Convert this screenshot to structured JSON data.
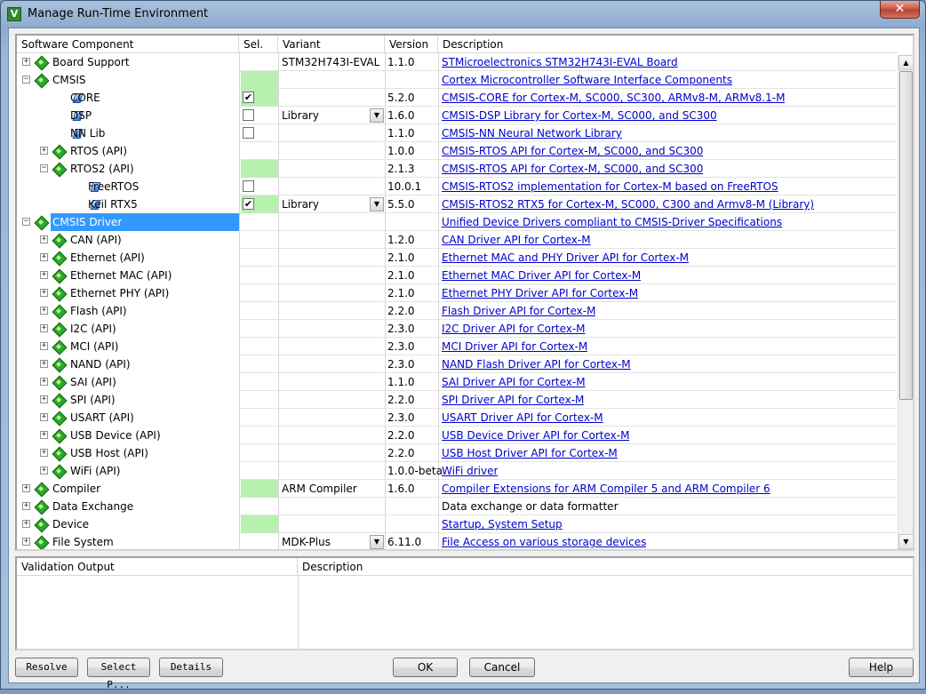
{
  "window": {
    "title": "Manage Run-Time Environment",
    "app_icon_letter": "V",
    "close_label": "✕"
  },
  "columns": {
    "component": "Software Component",
    "sel": "Sel.",
    "variant": "Variant",
    "version": "Version",
    "description": "Description"
  },
  "rows": [
    {
      "indent": 0,
      "expander": "+",
      "icon": "green-gem",
      "name": "Board Support",
      "sel": "",
      "checkbox": null,
      "variant": "STM32H743I-EVAL",
      "dropdown": false,
      "version": "1.1.0",
      "description": "STMicroelectronics STM32H743I-EVAL Board",
      "link": true,
      "highlight": false
    },
    {
      "indent": 0,
      "expander": "−",
      "icon": "green-gem",
      "name": "CMSIS",
      "sel": "green",
      "checkbox": null,
      "variant": "",
      "dropdown": false,
      "version": "",
      "description": "Cortex Microcontroller Software Interface Components",
      "link": true,
      "highlight": false
    },
    {
      "indent": 1,
      "expander": "",
      "icon": "blue-gem",
      "name": "CORE",
      "sel": "green",
      "checkbox": "checked",
      "variant": "",
      "dropdown": false,
      "version": "5.2.0",
      "description": "CMSIS-CORE for Cortex-M, SC000, SC300, ARMv8-M, ARMv8.1-M",
      "link": true,
      "highlight": false
    },
    {
      "indent": 1,
      "expander": "",
      "icon": "blue-gem",
      "name": "DSP",
      "sel": "",
      "checkbox": "unchecked",
      "variant": "Library",
      "dropdown": true,
      "version": "1.6.0",
      "description": "CMSIS-DSP Library for Cortex-M, SC000, and SC300",
      "link": true,
      "highlight": false
    },
    {
      "indent": 1,
      "expander": "",
      "icon": "blue-gem",
      "name": "NN Lib",
      "sel": "",
      "checkbox": "unchecked",
      "variant": "",
      "dropdown": false,
      "version": "1.1.0",
      "description": "CMSIS-NN Neural Network Library",
      "link": true,
      "highlight": false
    },
    {
      "indent": 1,
      "expander": "+",
      "icon": "green-gem",
      "name": "RTOS (API)",
      "sel": "",
      "checkbox": null,
      "variant": "",
      "dropdown": false,
      "version": "1.0.0",
      "description": "CMSIS-RTOS API for Cortex-M, SC000, and SC300",
      "link": true,
      "highlight": false
    },
    {
      "indent": 1,
      "expander": "−",
      "icon": "green-gem",
      "name": "RTOS2 (API)",
      "sel": "green",
      "checkbox": null,
      "variant": "",
      "dropdown": false,
      "version": "2.1.3",
      "description": "CMSIS-RTOS API for Cortex-M, SC000, and SC300",
      "link": true,
      "highlight": false
    },
    {
      "indent": 2,
      "expander": "",
      "icon": "blue-gem",
      "name": "FreeRTOS",
      "sel": "",
      "checkbox": "unchecked",
      "variant": "",
      "dropdown": false,
      "version": "10.0.1",
      "description": "CMSIS-RTOS2 implementation for Cortex-M based on FreeRTOS",
      "link": true,
      "highlight": false
    },
    {
      "indent": 2,
      "expander": "",
      "icon": "blue-gem",
      "name": "Keil RTX5",
      "sel": "green",
      "checkbox": "checked",
      "variant": "Library",
      "dropdown": true,
      "version": "5.5.0",
      "description": "CMSIS-RTOS2 RTX5 for Cortex-M, SC000, C300 and Armv8-M (Library)",
      "link": true,
      "highlight": false
    },
    {
      "indent": 0,
      "expander": "−",
      "icon": "green-gem",
      "name": "CMSIS Driver",
      "sel": "",
      "checkbox": null,
      "variant": "",
      "dropdown": false,
      "version": "",
      "description": "Unified Device Drivers compliant to CMSIS-Driver Specifications",
      "link": true,
      "highlight": true
    },
    {
      "indent": 1,
      "expander": "+",
      "icon": "green-gem",
      "name": "CAN (API)",
      "sel": "",
      "checkbox": null,
      "variant": "",
      "dropdown": false,
      "version": "1.2.0",
      "description": "CAN Driver API for Cortex-M",
      "link": true,
      "highlight": false
    },
    {
      "indent": 1,
      "expander": "+",
      "icon": "green-gem",
      "name": "Ethernet (API)",
      "sel": "",
      "checkbox": null,
      "variant": "",
      "dropdown": false,
      "version": "2.1.0",
      "description": "Ethernet MAC and PHY Driver API for Cortex-M",
      "link": true,
      "highlight": false
    },
    {
      "indent": 1,
      "expander": "+",
      "icon": "green-gem",
      "name": "Ethernet MAC (API)",
      "sel": "",
      "checkbox": null,
      "variant": "",
      "dropdown": false,
      "version": "2.1.0",
      "description": "Ethernet MAC Driver API for Cortex-M",
      "link": true,
      "highlight": false
    },
    {
      "indent": 1,
      "expander": "+",
      "icon": "green-gem",
      "name": "Ethernet PHY (API)",
      "sel": "",
      "checkbox": null,
      "variant": "",
      "dropdown": false,
      "version": "2.1.0",
      "description": "Ethernet PHY Driver API for Cortex-M",
      "link": true,
      "highlight": false
    },
    {
      "indent": 1,
      "expander": "+",
      "icon": "green-gem",
      "name": "Flash (API)",
      "sel": "",
      "checkbox": null,
      "variant": "",
      "dropdown": false,
      "version": "2.2.0",
      "description": "Flash Driver API for Cortex-M",
      "link": true,
      "highlight": false
    },
    {
      "indent": 1,
      "expander": "+",
      "icon": "green-gem",
      "name": "I2C (API)",
      "sel": "",
      "checkbox": null,
      "variant": "",
      "dropdown": false,
      "version": "2.3.0",
      "description": "I2C Driver API for Cortex-M",
      "link": true,
      "highlight": false
    },
    {
      "indent": 1,
      "expander": "+",
      "icon": "green-gem",
      "name": "MCI (API)",
      "sel": "",
      "checkbox": null,
      "variant": "",
      "dropdown": false,
      "version": "2.3.0",
      "description": "MCI Driver API for Cortex-M",
      "link": true,
      "highlight": false
    },
    {
      "indent": 1,
      "expander": "+",
      "icon": "green-gem",
      "name": "NAND (API)",
      "sel": "",
      "checkbox": null,
      "variant": "",
      "dropdown": false,
      "version": "2.3.0",
      "description": "NAND Flash Driver API for Cortex-M",
      "link": true,
      "highlight": false
    },
    {
      "indent": 1,
      "expander": "+",
      "icon": "green-gem",
      "name": "SAI (API)",
      "sel": "",
      "checkbox": null,
      "variant": "",
      "dropdown": false,
      "version": "1.1.0",
      "description": "SAI Driver API for Cortex-M",
      "link": true,
      "highlight": false
    },
    {
      "indent": 1,
      "expander": "+",
      "icon": "green-gem",
      "name": "SPI (API)",
      "sel": "",
      "checkbox": null,
      "variant": "",
      "dropdown": false,
      "version": "2.2.0",
      "description": "SPI Driver API for Cortex-M",
      "link": true,
      "highlight": false
    },
    {
      "indent": 1,
      "expander": "+",
      "icon": "green-gem",
      "name": "USART (API)",
      "sel": "",
      "checkbox": null,
      "variant": "",
      "dropdown": false,
      "version": "2.3.0",
      "description": "USART Driver API for Cortex-M",
      "link": true,
      "highlight": false
    },
    {
      "indent": 1,
      "expander": "+",
      "icon": "green-gem",
      "name": "USB Device (API)",
      "sel": "",
      "checkbox": null,
      "variant": "",
      "dropdown": false,
      "version": "2.2.0",
      "description": "USB Device Driver API for Cortex-M",
      "link": true,
      "highlight": false
    },
    {
      "indent": 1,
      "expander": "+",
      "icon": "green-gem",
      "name": "USB Host (API)",
      "sel": "",
      "checkbox": null,
      "variant": "",
      "dropdown": false,
      "version": "2.2.0",
      "description": "USB Host Driver API for Cortex-M",
      "link": true,
      "highlight": false
    },
    {
      "indent": 1,
      "expander": "+",
      "icon": "green-gem",
      "name": "WiFi (API)",
      "sel": "",
      "checkbox": null,
      "variant": "",
      "dropdown": false,
      "version": "1.0.0-beta",
      "description": "WiFi driver",
      "link": true,
      "highlight": false
    },
    {
      "indent": 0,
      "expander": "+",
      "icon": "green-gem",
      "name": "Compiler",
      "sel": "green",
      "checkbox": null,
      "variant": "ARM Compiler",
      "dropdown": false,
      "version": "1.6.0",
      "description": "Compiler Extensions for ARM Compiler 5 and ARM Compiler 6",
      "link": true,
      "highlight": false
    },
    {
      "indent": 0,
      "expander": "+",
      "icon": "green-gem",
      "name": "Data Exchange",
      "sel": "",
      "checkbox": null,
      "variant": "",
      "dropdown": false,
      "version": "",
      "description": "Data exchange or data formatter",
      "link": false,
      "highlight": false
    },
    {
      "indent": 0,
      "expander": "+",
      "icon": "green-gem",
      "name": "Device",
      "sel": "green",
      "checkbox": null,
      "variant": "",
      "dropdown": false,
      "version": "",
      "description": "Startup, System Setup",
      "link": true,
      "highlight": false
    },
    {
      "indent": 0,
      "expander": "+",
      "icon": "green-gem",
      "name": "File System",
      "sel": "",
      "checkbox": null,
      "variant": "MDK-Plus",
      "dropdown": true,
      "version": "6.11.0",
      "description": "File Access on various storage devices",
      "link": true,
      "highlight": false
    }
  ],
  "validation": {
    "col_output": "Validation Output",
    "col_description": "Description"
  },
  "buttons": {
    "resolve": "Resolve",
    "select_p": "Select P...",
    "details": "Details",
    "ok": "OK",
    "cancel": "Cancel",
    "help": "Help"
  },
  "colors": {
    "selection": "#3399ff",
    "sel_green": "#b8f0b0",
    "link": "#0000cc"
  }
}
